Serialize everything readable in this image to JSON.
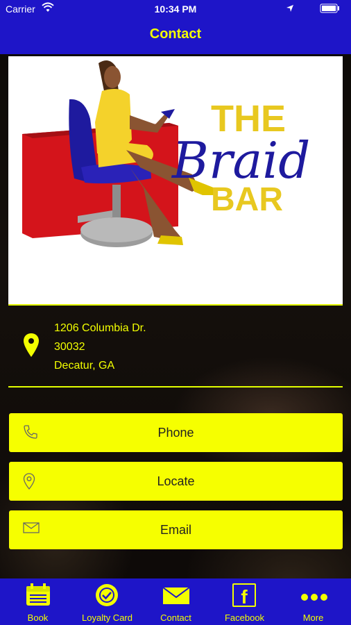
{
  "status_bar": {
    "carrier": "Carrier",
    "time": "10:34 PM"
  },
  "nav": {
    "title": "Contact"
  },
  "logo": {
    "line1": "THE",
    "line2": "Braid",
    "line3": "BAR"
  },
  "address": {
    "street": "1206 Columbia Dr.",
    "zip": "30032",
    "city": "Decatur, GA"
  },
  "actions": [
    {
      "label": "Phone",
      "icon": "phone-icon"
    },
    {
      "label": "Locate",
      "icon": "location-pin-icon"
    },
    {
      "label": "Email",
      "icon": "envelope-icon"
    }
  ],
  "tabs": [
    {
      "label": "Book",
      "icon": "calendar-icon"
    },
    {
      "label": "Loyalty Card",
      "icon": "badge-check-icon"
    },
    {
      "label": "Contact",
      "icon": "envelope-icon"
    },
    {
      "label": "Facebook",
      "icon": "facebook-icon"
    },
    {
      "label": "More",
      "icon": "more-dots-icon"
    }
  ],
  "colors": {
    "brand_blue": "#1e15c8",
    "accent_yellow": "#f6ff00",
    "text_yellow": "#f3ff00"
  }
}
